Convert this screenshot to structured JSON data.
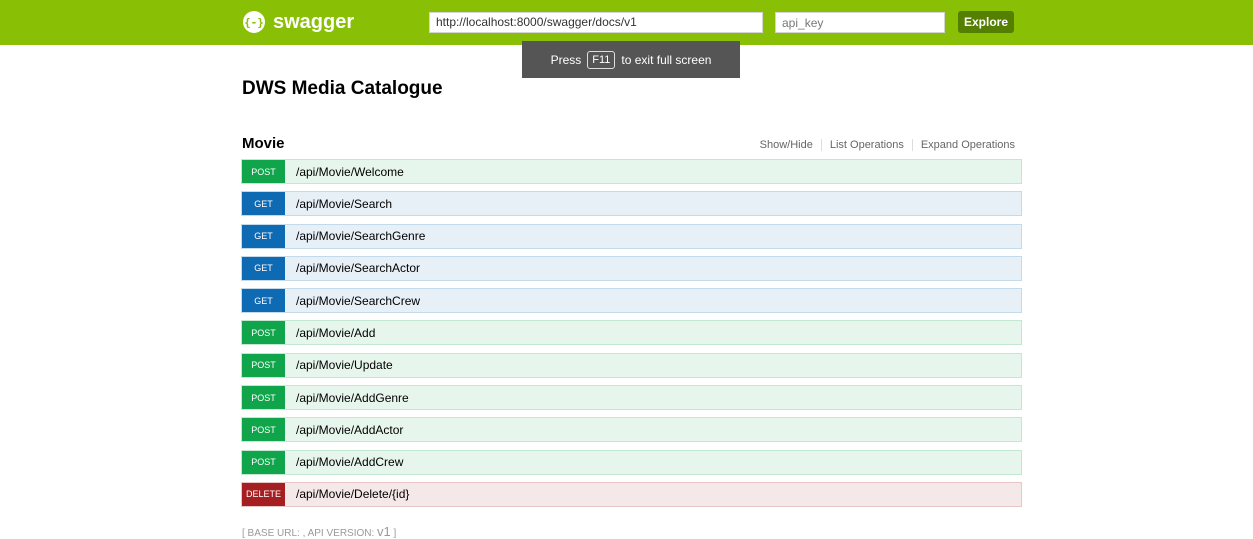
{
  "header": {
    "logo_text": "swagger",
    "logo_icon": "swagger-logo-icon",
    "url_value": "http://localhost:8000/swagger/docs/v1",
    "api_key_placeholder": "api_key",
    "explore_label": "Explore"
  },
  "fullscreen_notice": {
    "prefix": "Press",
    "key": "F11",
    "suffix": "to exit full screen"
  },
  "page_title": "DWS Media Catalogue",
  "section": {
    "title": "Movie",
    "links": [
      "Show/Hide",
      "List Operations",
      "Expand Operations"
    ]
  },
  "operations": [
    {
      "method": "POST",
      "path": "/api/Movie/Welcome"
    },
    {
      "method": "GET",
      "path": "/api/Movie/Search"
    },
    {
      "method": "GET",
      "path": "/api/Movie/SearchGenre"
    },
    {
      "method": "GET",
      "path": "/api/Movie/SearchActor"
    },
    {
      "method": "GET",
      "path": "/api/Movie/SearchCrew"
    },
    {
      "method": "POST",
      "path": "/api/Movie/Add"
    },
    {
      "method": "POST",
      "path": "/api/Movie/Update"
    },
    {
      "method": "POST",
      "path": "/api/Movie/AddGenre"
    },
    {
      "method": "POST",
      "path": "/api/Movie/AddActor"
    },
    {
      "method": "POST",
      "path": "/api/Movie/AddCrew"
    },
    {
      "method": "DELETE",
      "path": "/api/Movie/Delete/{id}"
    }
  ],
  "footer": {
    "text": "[ BASE URL: , API VERSION: ",
    "version": "v1",
    "close": " ]"
  },
  "colors": {
    "header_bg": "#89bf04",
    "post": "#10a54a",
    "get": "#0f6ab4",
    "delete": "#a41e22"
  }
}
